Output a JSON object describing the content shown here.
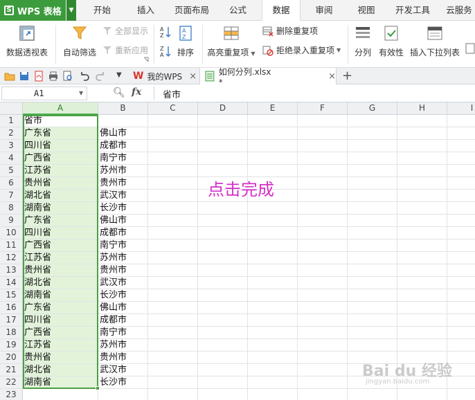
{
  "app": {
    "name": "WPS 表格",
    "brand_color": "#3c9b3c"
  },
  "menu_tabs": [
    "开始",
    "插入",
    "页面布局",
    "公式",
    "数据",
    "审阅",
    "视图",
    "开发工具",
    "云服务"
  ],
  "active_tab": "数据",
  "ribbon": {
    "pivot": "数据透视表",
    "autofilter": "自动筛选",
    "show_all": "全部显示",
    "reapply": "重新应用",
    "sort": "排序",
    "highlight_dup": "高亮重复项",
    "remove_dup": "删除重复项",
    "reject_dup": "拒绝录入重复项",
    "split": "分列",
    "validation": "有效性",
    "insert_dropdown": "插入下拉列表"
  },
  "doc_tabs": [
    {
      "label": "我的WPS"
    },
    {
      "label": "如何分列.xlsx *"
    }
  ],
  "formula_bar": {
    "cell_ref": "A1",
    "fx_label": "fx",
    "content": "省市"
  },
  "columns": [
    "A",
    "B",
    "C",
    "D",
    "E",
    "F",
    "G",
    "H",
    "I"
  ],
  "rows": [
    {
      "n": "1",
      "a": "省市",
      "b": ""
    },
    {
      "n": "2",
      "a": "广东省",
      "b": "佛山市"
    },
    {
      "n": "3",
      "a": "四川省",
      "b": "成都市"
    },
    {
      "n": "4",
      "a": "广西省",
      "b": "南宁市"
    },
    {
      "n": "5",
      "a": "江苏省",
      "b": "苏州市"
    },
    {
      "n": "6",
      "a": "贵州省",
      "b": "贵州市"
    },
    {
      "n": "7",
      "a": "湖北省",
      "b": "武汉市"
    },
    {
      "n": "8",
      "a": "湖南省",
      "b": "长沙市"
    },
    {
      "n": "9",
      "a": "广东省",
      "b": "佛山市"
    },
    {
      "n": "10",
      "a": "四川省",
      "b": "成都市"
    },
    {
      "n": "11",
      "a": "广西省",
      "b": "南宁市"
    },
    {
      "n": "12",
      "a": "江苏省",
      "b": "苏州市"
    },
    {
      "n": "13",
      "a": "贵州省",
      "b": "贵州市"
    },
    {
      "n": "14",
      "a": "湖北省",
      "b": "武汉市"
    },
    {
      "n": "15",
      "a": "湖南省",
      "b": "长沙市"
    },
    {
      "n": "16",
      "a": "广东省",
      "b": "佛山市"
    },
    {
      "n": "17",
      "a": "四川省",
      "b": "成都市"
    },
    {
      "n": "18",
      "a": "广西省",
      "b": "南宁市"
    },
    {
      "n": "19",
      "a": "江苏省",
      "b": "苏州市"
    },
    {
      "n": "20",
      "a": "贵州省",
      "b": "贵州市"
    },
    {
      "n": "21",
      "a": "湖北省",
      "b": "武汉市"
    },
    {
      "n": "22",
      "a": "湖南省",
      "b": "长沙市"
    },
    {
      "n": "23",
      "a": "",
      "b": ""
    }
  ],
  "annotation": "点击完成",
  "watermark": {
    "main": "Bai du 经验",
    "sub": "jingyan.baidu.com"
  }
}
